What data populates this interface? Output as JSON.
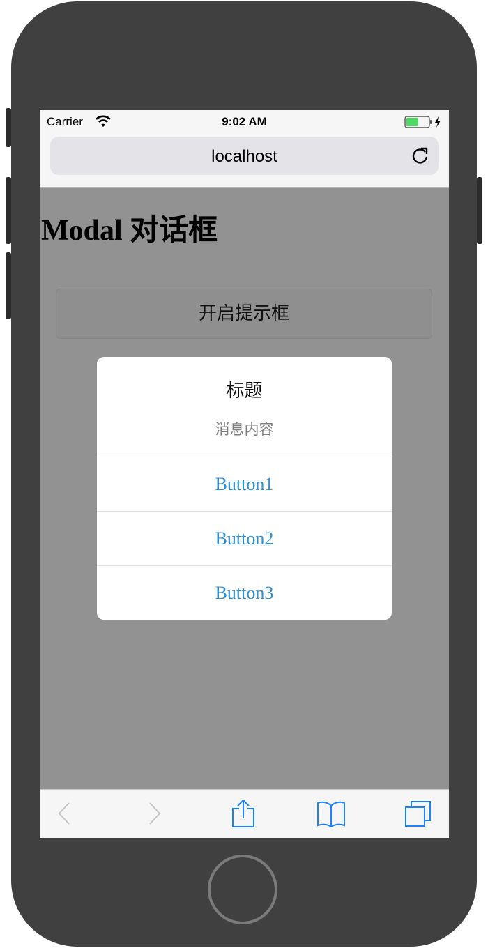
{
  "status_bar": {
    "carrier": "Carrier",
    "time": "9:02 AM",
    "wifi_icon": "wifi-icon",
    "battery_icon": "battery-charging-icon",
    "battery_color": "#4cd964"
  },
  "browser": {
    "url": "localhost",
    "reload_icon": "reload-icon"
  },
  "page": {
    "title": "Modal 对话框",
    "open_button_label": "开启提示框"
  },
  "modal": {
    "title": "标题",
    "content": "消息内容",
    "buttons": [
      "Button1",
      "Button2",
      "Button3"
    ],
    "button_color": "#2d8fd6"
  },
  "toolbar": {
    "icons": [
      "back-icon",
      "forward-icon",
      "share-icon",
      "bookmarks-icon",
      "tabs-icon"
    ],
    "accent": "#1a82fb"
  }
}
